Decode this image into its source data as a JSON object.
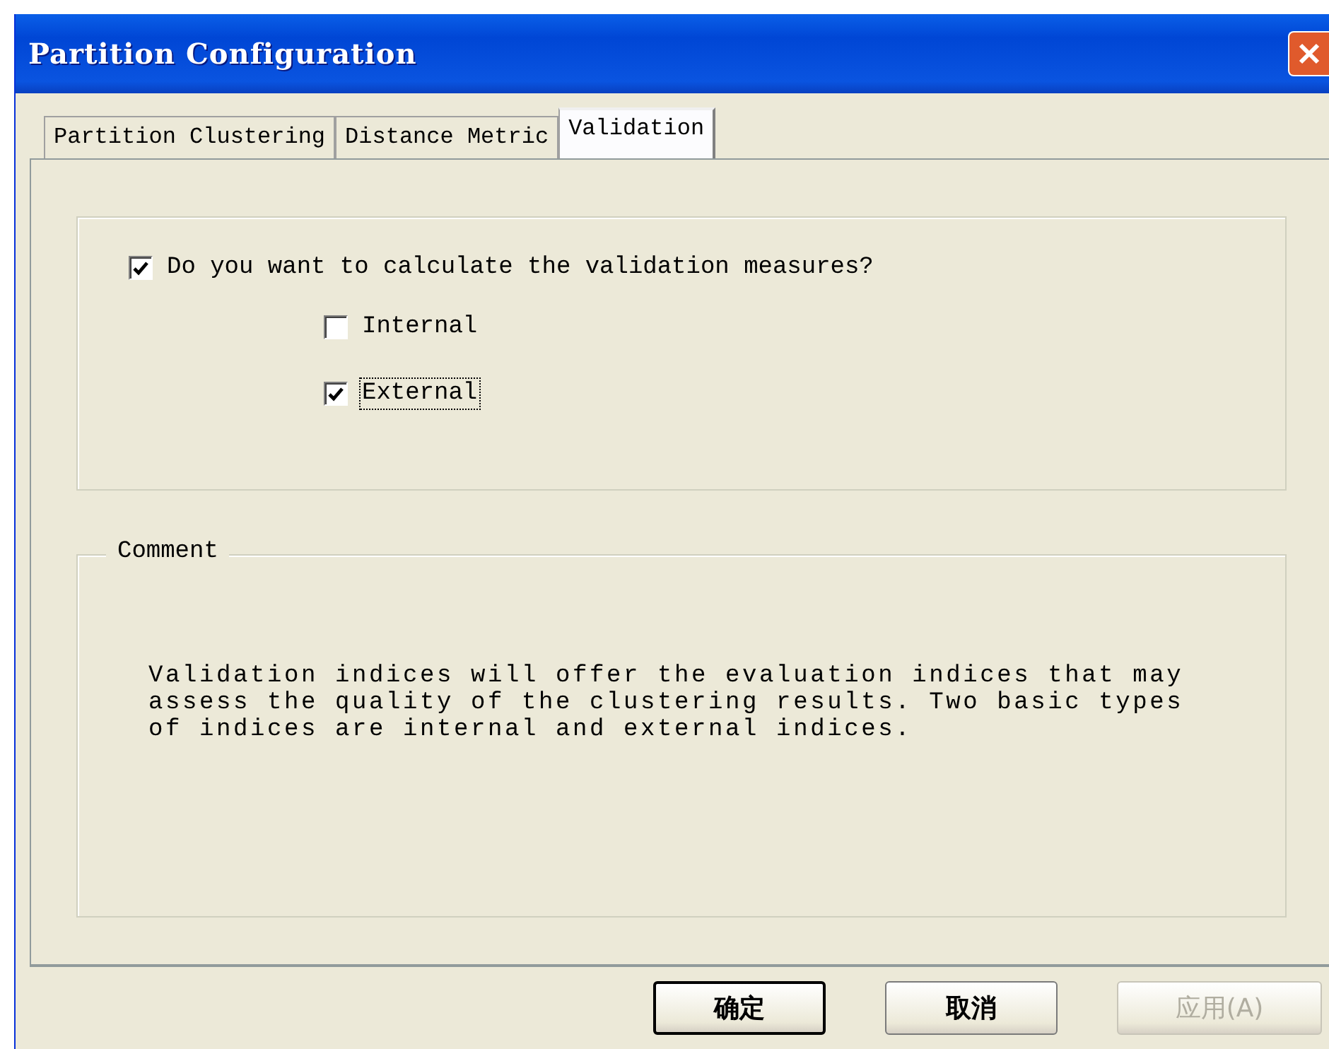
{
  "window": {
    "title": "Partition Configuration"
  },
  "tabs": [
    {
      "label": "Partition Clustering",
      "selected": false
    },
    {
      "label": "Distance Metric",
      "selected": false
    },
    {
      "label": "Validation",
      "selected": true
    }
  ],
  "main_option": {
    "label": "Do you want to calculate the validation measures?",
    "checked": true,
    "focused": false
  },
  "options": [
    {
      "label": "Internal",
      "checked": false,
      "focused": false
    },
    {
      "label": "External",
      "checked": true,
      "focused": true
    }
  ],
  "comment": {
    "title": "Comment",
    "text": "Validation indices will offer the evaluation indices that may\nassess the quality of the clustering results. Two basic types\nof indices are internal and external indices."
  },
  "buttons": [
    {
      "label": "确定",
      "default": true,
      "disabled": false
    },
    {
      "label": "取消",
      "default": false,
      "disabled": false
    },
    {
      "label": "应用(A)",
      "default": false,
      "disabled": true
    }
  ]
}
